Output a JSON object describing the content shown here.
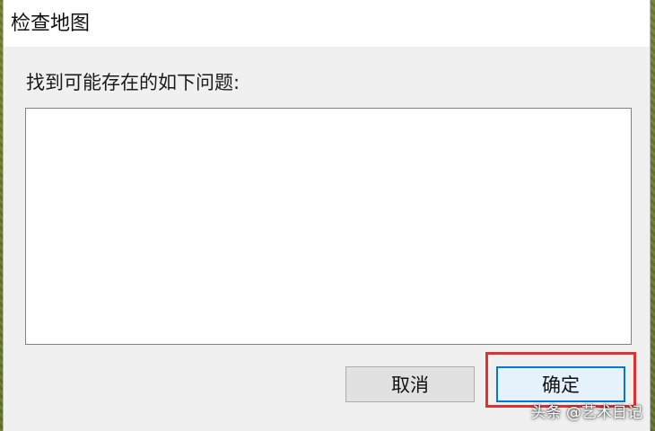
{
  "dialog": {
    "title": "检查地图",
    "prompt": "找到可能存在的如下问题:",
    "issues": []
  },
  "buttons": {
    "cancel_label": "取消",
    "ok_label": "确定"
  },
  "annotation": {
    "highlight_color": "#e23030"
  },
  "watermark": "头条 @艺术日记"
}
